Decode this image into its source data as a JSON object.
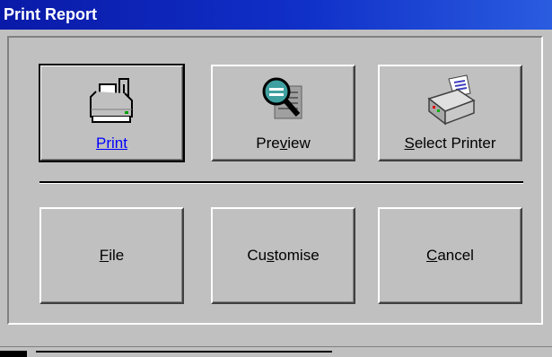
{
  "window": {
    "title": "Print Report"
  },
  "buttons": {
    "print": {
      "label": "Print",
      "icon": "printer-icon"
    },
    "preview": {
      "label_pre": "Pre",
      "label_ul": "v",
      "label_post": "iew",
      "icon": "magnifier-icon"
    },
    "select_printer": {
      "label_ul": "S",
      "label_post": "elect Printer",
      "icon": "printer-setup-icon"
    },
    "file": {
      "label_ul": "F",
      "label_post": "ile"
    },
    "customise": {
      "label_pre": "Cu",
      "label_ul": "s",
      "label_post": "tomise"
    },
    "cancel": {
      "label_ul": "C",
      "label_post": "ancel"
    }
  },
  "colors": {
    "titlebar": "#0a1aa8",
    "face": "#c0c0c0",
    "link": "#0000ff"
  }
}
